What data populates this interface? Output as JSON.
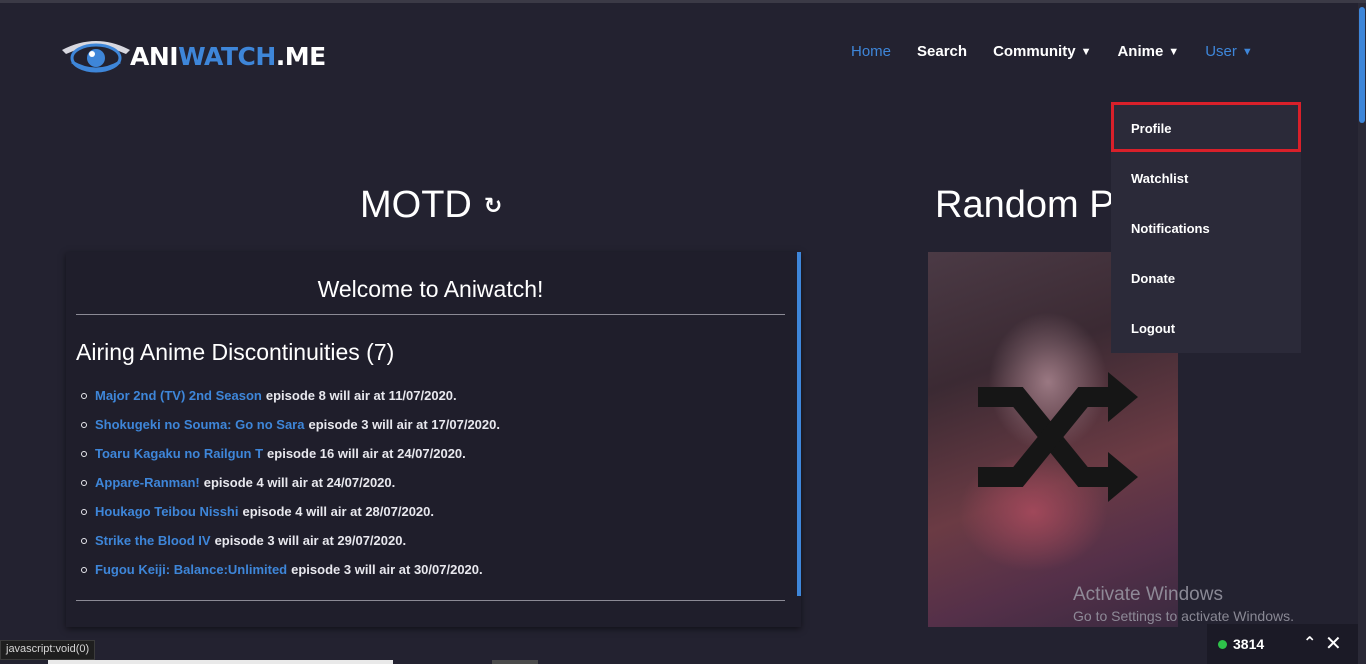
{
  "logo": {
    "ani": "ANI",
    "watch": "WATCH",
    "me": ".ME"
  },
  "nav": {
    "home": "Home",
    "search": "Search",
    "community": "Community",
    "anime": "Anime",
    "user": "User"
  },
  "user_menu": {
    "items": [
      "Profile",
      "Watchlist",
      "Notifications",
      "Donate",
      "Logout"
    ],
    "highlighted": "Profile"
  },
  "motd": {
    "title": "MOTD",
    "welcome": "Welcome to Aniwatch!",
    "airing_title": "Airing Anime Discontinuities (7)",
    "items": [
      {
        "anime": "Major 2nd (TV) 2nd Season",
        "text": "episode 8 will air at 11/07/2020."
      },
      {
        "anime": "Shokugeki no Souma: Go no Sara",
        "text": "episode 3 will air at 17/07/2020."
      },
      {
        "anime": "Toaru Kagaku no Railgun T",
        "text": "episode 16 will air at 24/07/2020."
      },
      {
        "anime": "Appare-Ranman!",
        "text": "episode 4 will air at 24/07/2020."
      },
      {
        "anime": "Houkago Teibou Nisshi",
        "text": "episode 4 will air at 28/07/2020."
      },
      {
        "anime": "Strike the Blood IV",
        "text": "episode 3 will air at 29/07/2020."
      },
      {
        "anime": "Fugou Keiji: Balance:Unlimited",
        "text": "episode 3 will air at 30/07/2020."
      }
    ]
  },
  "random": {
    "title": "Random P"
  },
  "windows": {
    "line1": "Activate Windows",
    "line2": "Go to Settings to activate Windows."
  },
  "online": {
    "count": "3814"
  },
  "statusbar": {
    "text": "javascript:void(0)"
  },
  "colors": {
    "accent": "#3e86d9",
    "background": "#232230",
    "highlight": "#d9202a",
    "online": "#2ec24a"
  },
  "icons": {
    "refresh": "refresh-icon",
    "shuffle": "shuffle-icon",
    "caret": "chevron-down-icon"
  }
}
